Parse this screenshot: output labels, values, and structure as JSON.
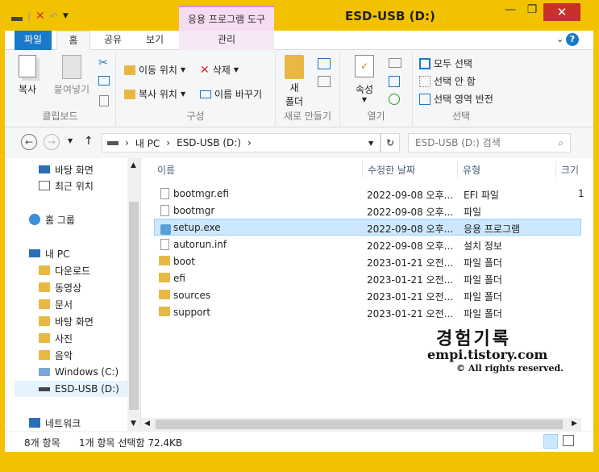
{
  "window": {
    "title": "ESD-USB (D:)",
    "context_tab": "응용 프로그램 도구"
  },
  "tabs": {
    "file": "파일",
    "home": "홈",
    "share": "공유",
    "view": "보기",
    "manage": "관리"
  },
  "ribbon": {
    "clipboard": {
      "copy": "복사",
      "paste": "붙여넣기",
      "group": "클립보드"
    },
    "organize": {
      "move_to": "이동 위치",
      "copy_to": "복사 위치",
      "delete": "삭제",
      "rename": "이름 바꾸기",
      "group": "구성"
    },
    "new": {
      "new_folder_line1": "새",
      "new_folder_line2": "폴더",
      "group": "새로 만들기"
    },
    "open": {
      "properties": "속성",
      "group": "열기"
    },
    "select": {
      "select_all": "모두 선택",
      "select_none": "선택 안 함",
      "invert": "선택 영역 반전",
      "group": "선택"
    }
  },
  "address": {
    "pc": "내 PC",
    "drive": "ESD-USB (D:)",
    "search_placeholder": "ESD-USB (D:) 검색"
  },
  "nav": {
    "items": [
      {
        "label": "바탕 화면"
      },
      {
        "label": "최근 위치"
      },
      {
        "label": "홈 그룹"
      },
      {
        "label": "내 PC"
      },
      {
        "label": "다운로드"
      },
      {
        "label": "동영상"
      },
      {
        "label": "문서"
      },
      {
        "label": "바탕 화면"
      },
      {
        "label": "사진"
      },
      {
        "label": "음악"
      },
      {
        "label": "Windows (C:)"
      },
      {
        "label": "ESD-USB (D:)"
      },
      {
        "label": "네트워크"
      }
    ]
  },
  "columns": {
    "name": "이름",
    "modified": "수정한 날짜",
    "type": "유형",
    "size": "크기"
  },
  "files": [
    {
      "name": "bootmgr.efi",
      "modified": "2022-09-08 오후...",
      "type": "EFI 파일",
      "size": "1"
    },
    {
      "name": "bootmgr",
      "modified": "2022-09-08 오후...",
      "type": "파일",
      "size": ""
    },
    {
      "name": "setup.exe",
      "modified": "2022-09-08 오후...",
      "type": "응용 프로그램",
      "size": ""
    },
    {
      "name": "autorun.inf",
      "modified": "2022-09-08 오후...",
      "type": "설치 정보",
      "size": ""
    },
    {
      "name": "boot",
      "modified": "2023-01-21 오전...",
      "type": "파일 폴더",
      "size": ""
    },
    {
      "name": "efi",
      "modified": "2023-01-21 오전...",
      "type": "파일 폴더",
      "size": ""
    },
    {
      "name": "sources",
      "modified": "2023-01-21 오전...",
      "type": "파일 폴더",
      "size": ""
    },
    {
      "name": "support",
      "modified": "2023-01-21 오전...",
      "type": "파일 폴더",
      "size": ""
    }
  ],
  "status": {
    "count": "8개 항목",
    "selection": "1개 항목 선택함 72.4KB"
  },
  "watermark": {
    "line1": "경험기록",
    "line2": "empi.tistory.com",
    "line3": "© All rights reserved."
  },
  "colors": {
    "accent": "#1979ca",
    "frame": "#f2c200",
    "close": "#c7302b",
    "selection": "#cce8ff"
  }
}
